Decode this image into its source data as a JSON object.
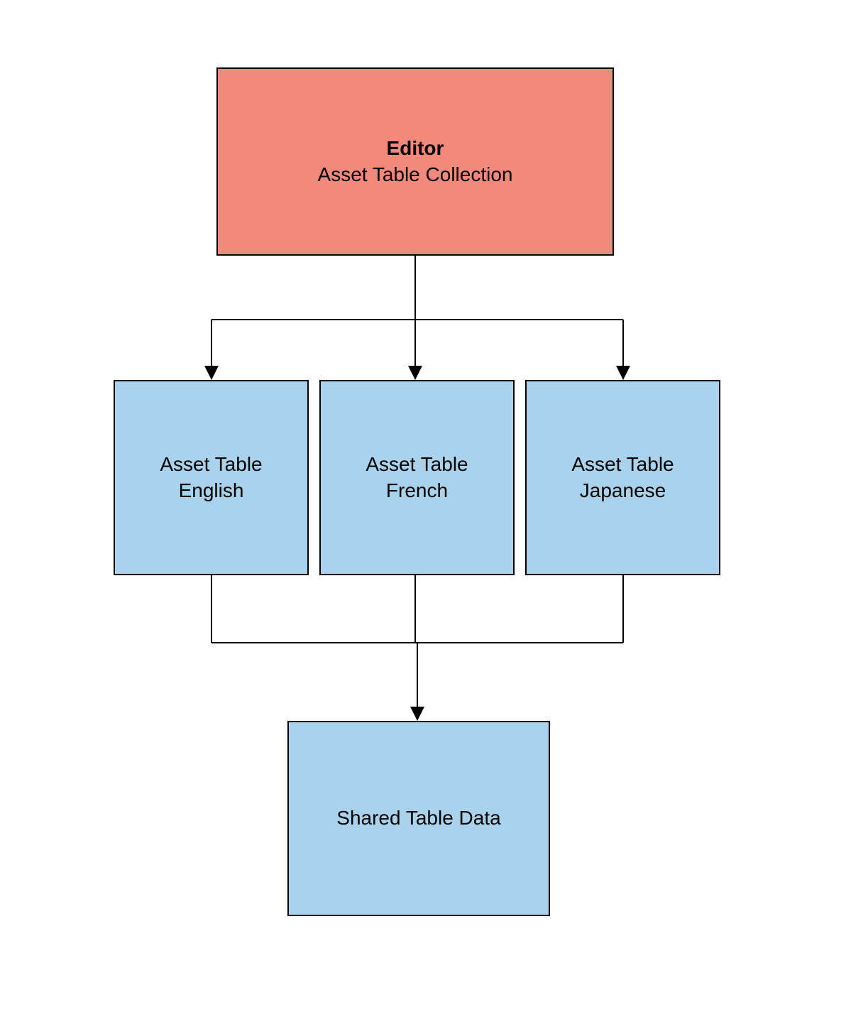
{
  "nodes": {
    "root": {
      "title": "Editor",
      "subtitle": "Asset Table Collection",
      "color": "#f18a7a"
    },
    "children": [
      {
        "line1": "Asset Table",
        "line2": "English",
        "color": "#a9d3ed"
      },
      {
        "line1": "Asset Table",
        "line2": "French",
        "color": "#a9d3ed"
      },
      {
        "line1": "Asset Table",
        "line2": "Japanese",
        "color": "#a9d3ed"
      }
    ],
    "shared": {
      "label": "Shared Table Data",
      "color": "#a9d3ed"
    }
  },
  "edges": [
    {
      "from": "root",
      "to": "child0",
      "arrow": true
    },
    {
      "from": "root",
      "to": "child1",
      "arrow": true
    },
    {
      "from": "root",
      "to": "child2",
      "arrow": true
    },
    {
      "from": "child0",
      "to": "shared",
      "arrow": false
    },
    {
      "from": "child1",
      "to": "shared",
      "arrow": true
    },
    {
      "from": "child2",
      "to": "shared",
      "arrow": false
    }
  ]
}
